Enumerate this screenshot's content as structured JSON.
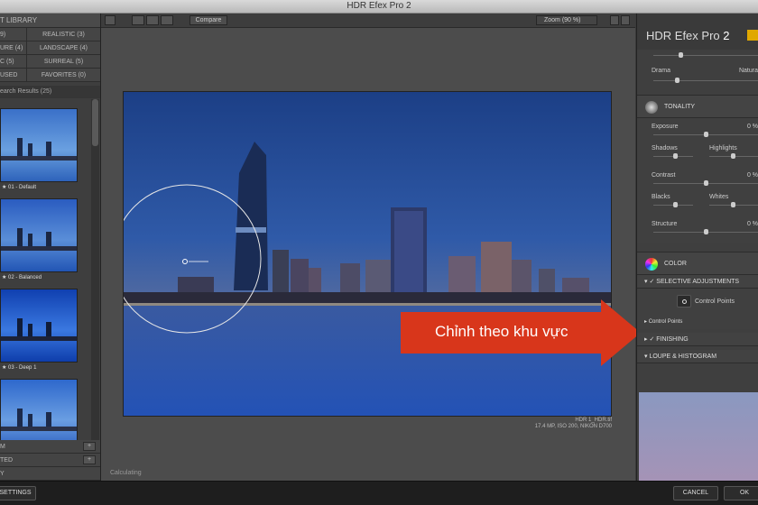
{
  "window": {
    "title": "HDR Efex Pro 2"
  },
  "left_panel": {
    "header": "T LIBRARY",
    "categories": [
      {
        "left": "9)",
        "right": "REALISTIC (3)"
      },
      {
        "left": "URE (4)",
        "right": "LANDSCAPE (4)"
      },
      {
        "left": "C (5)",
        "right": "SURREAL (5)"
      },
      {
        "left": "USED",
        "right": "FAVORITES (0)"
      }
    ],
    "search_results": "earch Results (25)",
    "presets": [
      {
        "caption": "★ 01 - Default"
      },
      {
        "caption": "★ 02 - Balanced"
      },
      {
        "caption": "★ 03 - Deep 1"
      },
      {
        "caption": ""
      }
    ],
    "bottom_rows": [
      {
        "label": "M",
        "button": "+"
      },
      {
        "label": "TED",
        "button": "+"
      },
      {
        "label": "Y",
        "button": ""
      }
    ]
  },
  "center": {
    "compare_label": "Compare",
    "zoom_label": "Zoom (90 %)",
    "photo_meta_line1": "HDR 1_HDR.tif",
    "photo_meta_line2": "17.4 MP, ISO 200, NIKON D700",
    "calculating": "Calculating",
    "callout_text": "Chỉnh theo khu vực"
  },
  "right_panel": {
    "title_main": "HDR Efex Pro",
    "title_num": "2",
    "drama_label": "Drama",
    "natural_label": "Natura",
    "tonality_label": "TONALITY",
    "exposure_label": "Exposure",
    "exposure_value": "0 %",
    "shadows_label": "Shadows",
    "highlights_label": "Highlights",
    "contrast_label": "Contrast",
    "contrast_value": "0 %",
    "blacks_label": "Blacks",
    "whites_label": "Whites",
    "structure_label": "Structure",
    "structure_value": "0 %",
    "color_label": "COLOR",
    "selective_label": "SELECTIVE ADJUSTMENTS",
    "control_points_label": "Control Points",
    "control_points_sub": "Control Points",
    "finishing_label": "FINISHING",
    "loupe_label": "LOUPE & HISTOGRAM"
  },
  "bottom_bar": {
    "settings_label": "SETTINGS",
    "cancel_label": "CANCEL",
    "ok_label": "OK"
  },
  "colors": {
    "callout_red": "#d8361b",
    "sky_top": "#1c3f86",
    "water": "#2c58b8"
  }
}
